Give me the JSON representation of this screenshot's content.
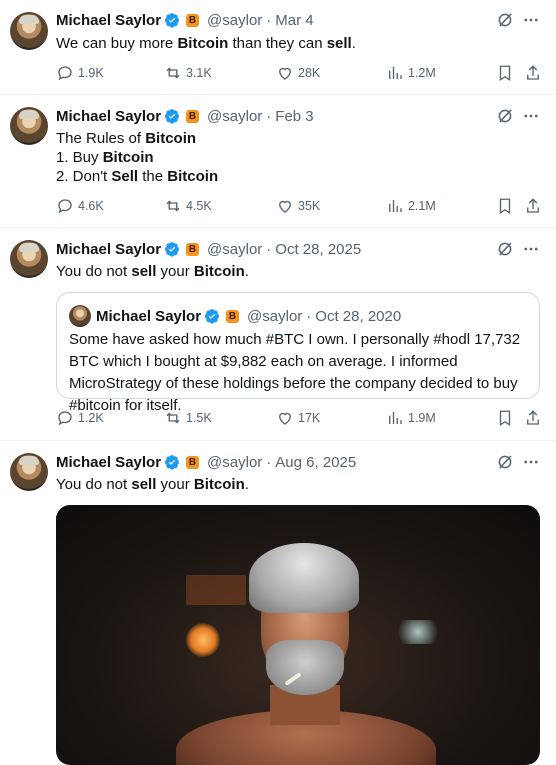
{
  "tweets": [
    {
      "name": "Michael Saylor",
      "badge": "B",
      "handle": "@saylor",
      "date": "Mar 4",
      "segments": [
        {
          "t": "We can buy more ",
          "b": false
        },
        {
          "t": "Bitcoin",
          "b": true
        },
        {
          "t": " than they can ",
          "b": false
        },
        {
          "t": "sell",
          "b": true
        },
        {
          "t": ".",
          "b": false
        }
      ],
      "replies": "1.9K",
      "reposts": "3.1K",
      "likes": "28K",
      "views": "1.2M"
    },
    {
      "name": "Michael Saylor",
      "badge": "B",
      "handle": "@saylor",
      "date": "Feb 3",
      "lines": [
        [
          {
            "t": "The Rules of ",
            "b": false
          },
          {
            "t": "Bitcoin",
            "b": true
          }
        ],
        [
          {
            "t": "1. Buy ",
            "b": false
          },
          {
            "t": "Bitcoin",
            "b": true
          }
        ],
        [
          {
            "t": "2. Don't ",
            "b": false
          },
          {
            "t": "Sell",
            "b": true
          },
          {
            "t": " the ",
            "b": false
          },
          {
            "t": "Bitcoin",
            "b": true
          }
        ]
      ],
      "replies": "4.6K",
      "reposts": "4.5K",
      "likes": "35K",
      "views": "2.1M"
    },
    {
      "name": "Michael Saylor",
      "badge": "B",
      "handle": "@saylor",
      "date": "Oct 28, 2025",
      "segments": [
        {
          "t": "You do not ",
          "b": false
        },
        {
          "t": "sell",
          "b": true
        },
        {
          "t": " your ",
          "b": false
        },
        {
          "t": "Bitcoin",
          "b": true
        },
        {
          "t": ".",
          "b": false
        }
      ],
      "quote": {
        "name": "Michael Saylor",
        "badge": "B",
        "handle": "@saylor",
        "date": "Oct 28, 2020",
        "text": "Some have asked how much #BTC I own. I personally #hodl 17,732 BTC which I bought at $9,882 each on average. I informed MicroStrategy of these holdings before the company decided to buy #bitcoin for itself."
      },
      "replies": "1.2K",
      "reposts": "1.5K",
      "likes": "17K",
      "views": "1.9M"
    },
    {
      "name": "Michael Saylor",
      "badge": "B",
      "handle": "@saylor",
      "date": "Aug 6, 2025",
      "segments": [
        {
          "t": "You do not ",
          "b": false
        },
        {
          "t": "sell",
          "b": true
        },
        {
          "t": " your ",
          "b": false
        },
        {
          "t": "Bitcoin",
          "b": true
        },
        {
          "t": ".",
          "b": false
        }
      ]
    }
  ],
  "separator": "·",
  "colors": {
    "verified": "#1d9bf0",
    "badge": "#f7931a",
    "muted": "#536471",
    "text": "#0f1419",
    "border": "#eff3f4"
  },
  "icons": [
    "verified-badge-icon",
    "grok-icon",
    "more-icon",
    "reply-icon",
    "repost-icon",
    "like-icon",
    "views-icon",
    "bookmark-icon",
    "share-icon"
  ]
}
